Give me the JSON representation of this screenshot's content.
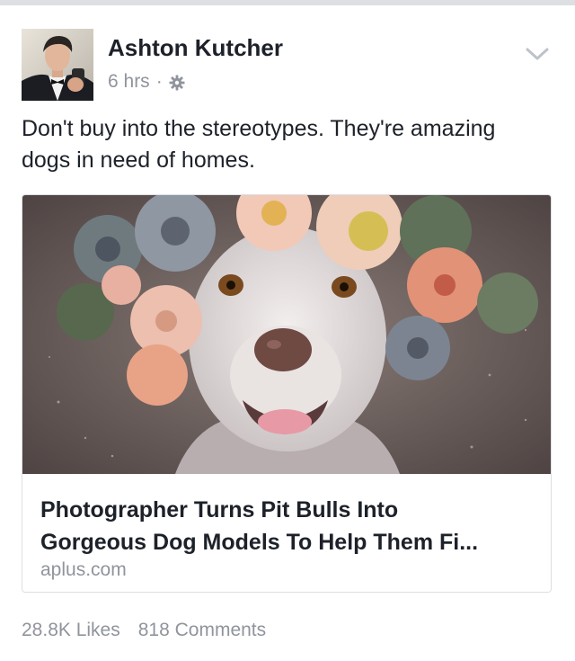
{
  "post": {
    "author": "Ashton Kutcher",
    "time": "6 hrs",
    "separator": "·",
    "privacy_icon": "gear-icon",
    "menu_icon": "chevron-down-icon",
    "text": "Don't buy into the stereotypes. They're amazing dogs in need of homes."
  },
  "link_card": {
    "title_line1": "Photographer Turns Pit Bulls Into",
    "title_line2": "Gorgeous Dog Models To Help Them Fi...",
    "domain": "aplus.com"
  },
  "stats": {
    "likes": "28.8K Likes",
    "comments": "818 Comments"
  },
  "colors": {
    "text_primary": "#1d2129",
    "text_secondary": "#90949c",
    "border": "#dddfe2"
  }
}
